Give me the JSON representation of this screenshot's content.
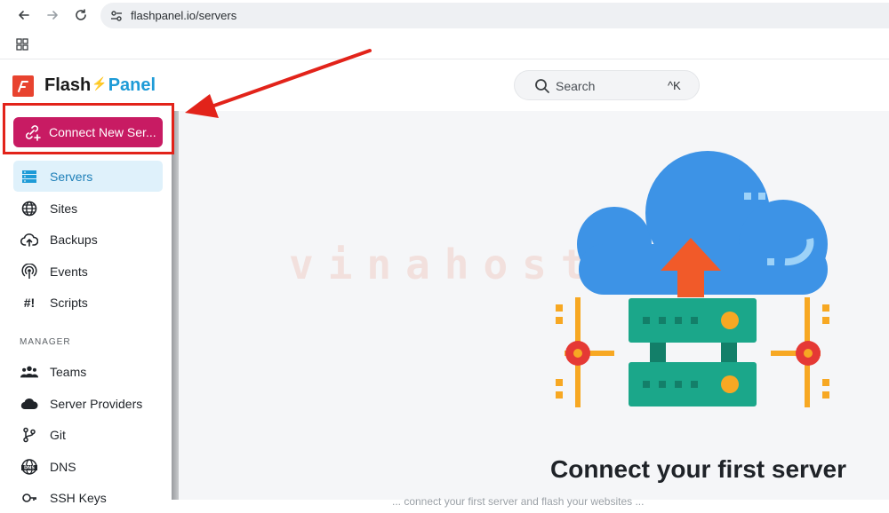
{
  "browser": {
    "url": "flashpanel.io/servers",
    "back_icon": "arrow-left-icon",
    "forward_icon": "arrow-right-icon",
    "reload_icon": "reload-icon",
    "site_info_icon": "tune-icon",
    "apps_icon": "apps-grid-icon"
  },
  "header": {
    "logo_flash": "Flash",
    "logo_panel": "Panel",
    "search_placeholder": "Search",
    "search_shortcut": "^K"
  },
  "sidebar": {
    "connect_button": "Connect New Ser...",
    "items": [
      {
        "label": "Servers",
        "icon": "servers-icon",
        "active": true
      },
      {
        "label": "Sites",
        "icon": "globe-icon"
      },
      {
        "label": "Backups",
        "icon": "cloud-upload-icon"
      },
      {
        "label": "Events",
        "icon": "broadcast-icon"
      },
      {
        "label": "Scripts",
        "icon": "script-icon",
        "glyph": "#!"
      }
    ],
    "manager_label": "MANAGER",
    "manager_items": [
      {
        "label": "Teams",
        "icon": "users-icon"
      },
      {
        "label": "Server Providers",
        "icon": "cloud-icon"
      },
      {
        "label": "Git",
        "icon": "git-branch-icon"
      },
      {
        "label": "DNS",
        "icon": "dns-globe-icon"
      },
      {
        "label": "SSH Keys",
        "icon": "key-icon"
      }
    ]
  },
  "main": {
    "title": "Connect your first server",
    "subtitle": "... connect your first server and flash your websites ...",
    "watermark": "vinahost."
  },
  "colors": {
    "accent": "#c81b63",
    "active_bg": "#dff1fb",
    "active_text": "#1e7fb8",
    "annotation_red": "#e2231a",
    "brand_blue": "#1e9bd7"
  }
}
